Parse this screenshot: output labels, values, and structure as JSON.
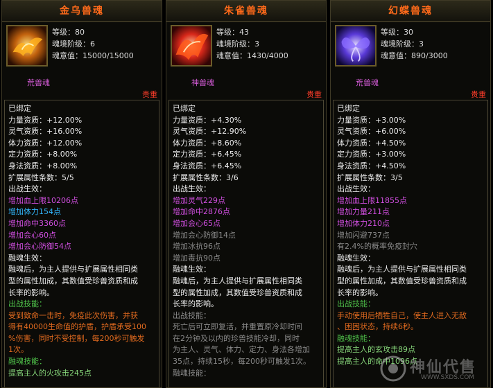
{
  "panels": [
    {
      "title": "金乌兽魂",
      "icon": "golden-crow-icon",
      "level_label": "等级：80",
      "rank_label": "魂境阶级：6",
      "will_label": "魂意值：15000/15000",
      "kind": "荒兽魂",
      "quality": "贵重",
      "lines": [
        {
          "text": "已绑定",
          "color": "white"
        },
        {
          "text": "力量资质：+12.00%",
          "color": "white"
        },
        {
          "text": "灵气资质：+16.00%",
          "color": "white"
        },
        {
          "text": "体力资质：+12.00%",
          "color": "white"
        },
        {
          "text": "定力资质：+8.00%",
          "color": "white"
        },
        {
          "text": "身法资质：+8.00%",
          "color": "white"
        },
        {
          "text": "扩展属性条数：5/5",
          "color": "white"
        },
        {
          "text": "出战生效：",
          "color": "white"
        },
        {
          "text": "增加血上限10206点",
          "color": "purple"
        },
        {
          "text": "增加体力154点",
          "color": "cyan"
        },
        {
          "text": "增加命中3360点",
          "color": "purple"
        },
        {
          "text": "增加会心60点",
          "color": "purple"
        },
        {
          "text": "增加会心防御54点",
          "color": "purple"
        },
        {
          "text": "融魂生效：",
          "color": "white"
        },
        {
          "text": "融魂后，为主人提供与扩展属性相同类",
          "color": "white"
        },
        {
          "text": "型的属性加成，其数值受珍兽资质和成",
          "color": "white"
        },
        {
          "text": "长率的影响。",
          "color": "white"
        },
        {
          "text": "出战技能：",
          "color": "green"
        },
        {
          "text": "受到致命一击时，免疫此次伤害，并获",
          "color": "orange"
        },
        {
          "text": "得有40000生命值的护盾，护盾承受100",
          "color": "orange"
        },
        {
          "text": "%伤害，同时不受控制，每200秒可触发",
          "color": "orange"
        },
        {
          "text": "1次。",
          "color": "orange"
        },
        {
          "text": "融魂技能：",
          "color": "green"
        },
        {
          "text": "提高主人的火攻击245点",
          "color": "ltgreen"
        }
      ]
    },
    {
      "title": "朱雀兽魂",
      "icon": "vermilion-bird-icon",
      "level_label": "等级：43",
      "rank_label": "魂境阶级：3",
      "will_label": "魂意值：1430/4000",
      "kind": "神兽魂",
      "quality": "贵重",
      "lines": [
        {
          "text": "已绑定",
          "color": "white"
        },
        {
          "text": "力量资质：+4.30%",
          "color": "white"
        },
        {
          "text": "灵气资质：+12.90%",
          "color": "white"
        },
        {
          "text": "体力资质：+8.60%",
          "color": "white"
        },
        {
          "text": "定力资质：+6.45%",
          "color": "white"
        },
        {
          "text": "身法资质：+6.45%",
          "color": "white"
        },
        {
          "text": "扩展属性条数：3/6",
          "color": "white"
        },
        {
          "text": "出战生效：",
          "color": "white"
        },
        {
          "text": "增加灵气229点",
          "color": "purple"
        },
        {
          "text": "增加命中2876点",
          "color": "purple"
        },
        {
          "text": "增加会心65点",
          "color": "purple"
        },
        {
          "text": "增加会心防御14点",
          "color": "grey"
        },
        {
          "text": "增加冰抗96点",
          "color": "grey"
        },
        {
          "text": "增加毒抗90点",
          "color": "grey"
        },
        {
          "text": "融魂生效：",
          "color": "white"
        },
        {
          "text": "融魂后，为主人提供与扩展属性相同类",
          "color": "white"
        },
        {
          "text": "型的属性加成，其数值受珍兽资质和成",
          "color": "white"
        },
        {
          "text": "长率的影响。",
          "color": "white"
        },
        {
          "text": "出战技能：",
          "color": "grey"
        },
        {
          "text": "死亡后可立即复活，并重置原冷却时间",
          "color": "grey"
        },
        {
          "text": "在2分钟及以内的珍兽技能冷却，同时",
          "color": "grey"
        },
        {
          "text": "为主人、灵气、体力、定力、身法各增加",
          "color": "grey"
        },
        {
          "text": "35点，持续15秒，每200秒可触发1次。",
          "color": "grey"
        },
        {
          "text": "融魂技能：",
          "color": "grey"
        }
      ]
    },
    {
      "title": "幻蝶兽魂",
      "icon": "phantom-butterfly-icon",
      "level_label": "等级：30",
      "rank_label": "魂境阶级：3",
      "will_label": "魂意值：890/3000",
      "kind": "荒兽魂",
      "quality": "贵重",
      "lines": [
        {
          "text": "已绑定",
          "color": "white"
        },
        {
          "text": "力量资质：+3.00%",
          "color": "white"
        },
        {
          "text": "灵气资质：+6.00%",
          "color": "white"
        },
        {
          "text": "体力资质：+4.50%",
          "color": "white"
        },
        {
          "text": "定力资质：+3.00%",
          "color": "white"
        },
        {
          "text": "身法资质：+4.50%",
          "color": "white"
        },
        {
          "text": "扩展属性条数：3/5",
          "color": "white"
        },
        {
          "text": "出战生效：",
          "color": "white"
        },
        {
          "text": "增加血上限11855点",
          "color": "purple"
        },
        {
          "text": "增加力量211点",
          "color": "purple"
        },
        {
          "text": "增加体力210点",
          "color": "purple"
        },
        {
          "text": "增加闪避737点",
          "color": "grey"
        },
        {
          "text": "有2.4%的概率免疫封穴",
          "color": "grey"
        },
        {
          "text": "融魂生效：",
          "color": "white"
        },
        {
          "text": "融魂后，为主人提供与扩展属性相同类",
          "color": "white"
        },
        {
          "text": "型的属性加成，其数值受珍兽资质和成",
          "color": "white"
        },
        {
          "text": "长率的影响。",
          "color": "white"
        },
        {
          "text": "出战技能：",
          "color": "green"
        },
        {
          "text": "手动使用后牺牲自己，使主人进入无敌",
          "color": "orange"
        },
        {
          "text": "、困困状态，持续6秒。",
          "color": "orange"
        },
        {
          "text": "融魂技能：",
          "color": "green"
        },
        {
          "text": "提高主人的玄攻击89点",
          "color": "ltgreen"
        },
        {
          "text": "提高主人的命中1096点",
          "color": "ltgreen"
        }
      ]
    }
  ],
  "watermark": {
    "text": "神仙代售",
    "url": "WWW.SXDS.COM"
  }
}
